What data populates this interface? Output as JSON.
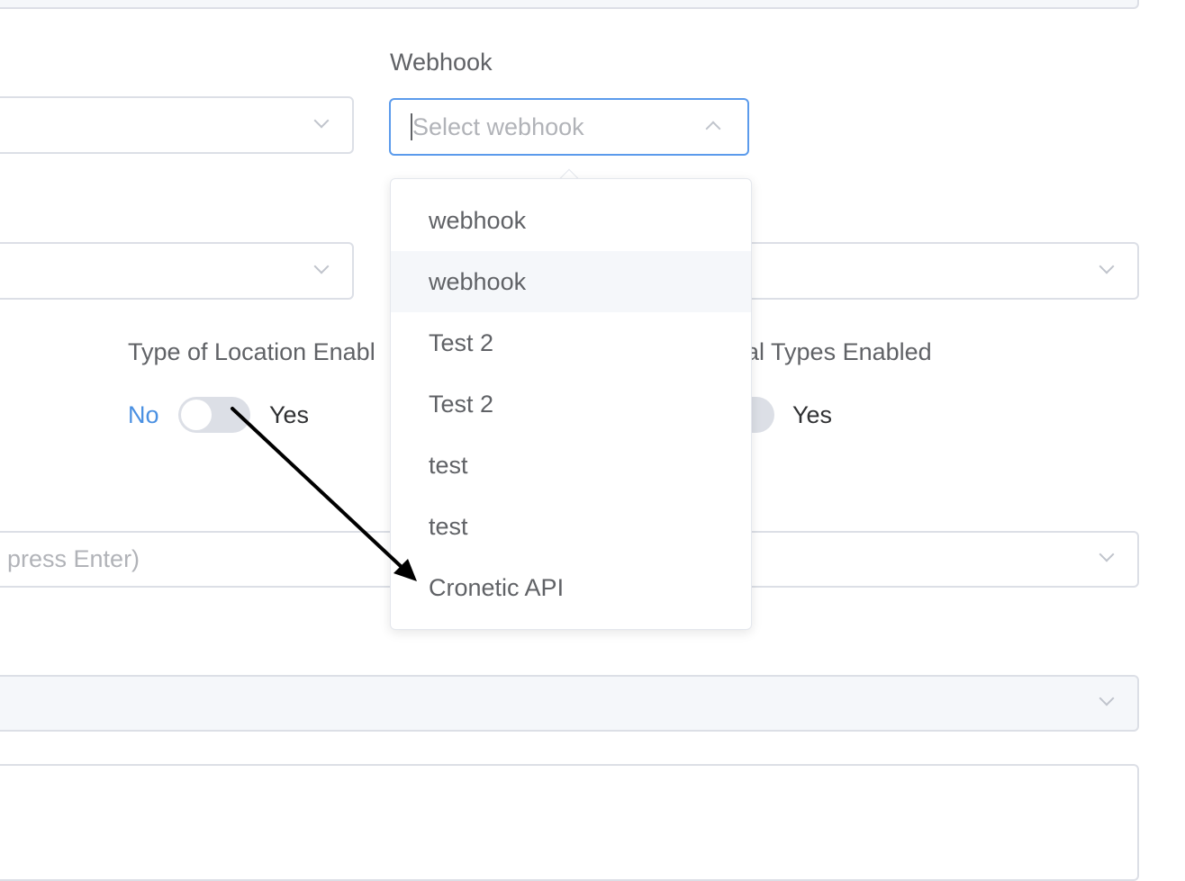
{
  "form": {
    "webhook_label": "Webhook",
    "webhook_placeholder": "Select webhook",
    "location_label": "Type of Location Enabl",
    "types_label": "al Types Enabled",
    "tags_placeholder": "press Enter)",
    "switch_location": {
      "off_label": "No",
      "on_label": "Yes"
    },
    "switch_types": {
      "on_label": "Yes"
    }
  },
  "dropdown": {
    "options": [
      "webhook",
      "webhook",
      "Test 2",
      "Test 2",
      "test",
      "test",
      "Cronetic API"
    ]
  },
  "annotation": {
    "arrow_color": "#000000"
  },
  "colors": {
    "accent": "#5b9bec",
    "switch_off_label": "#4a90e2"
  }
}
